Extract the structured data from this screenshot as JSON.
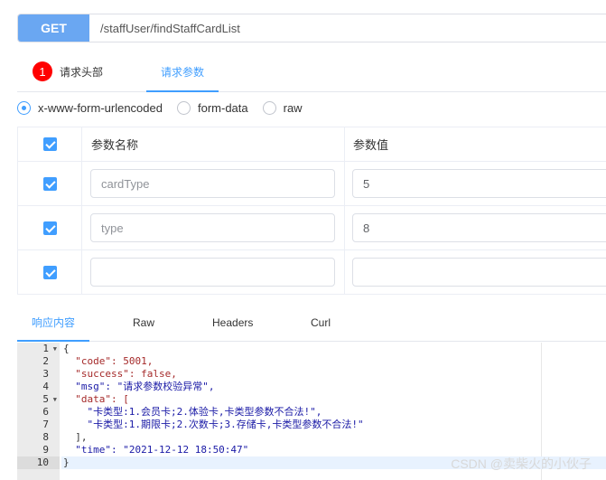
{
  "request": {
    "method": "GET",
    "url": "/staffUser/findStaffCardList"
  },
  "req_tabs": {
    "headers_badge": "1",
    "headers_label": "请求头部",
    "params_label": "请求参数"
  },
  "body_types": {
    "urlencoded": "x-www-form-urlencoded",
    "formdata": "form-data",
    "raw": "raw"
  },
  "params_table": {
    "col_name": "参数名称",
    "col_value": "参数值",
    "rows": [
      {
        "name": "cardType",
        "value": "5"
      },
      {
        "name": "type",
        "value": "8"
      },
      {
        "name": "",
        "value": ""
      }
    ]
  },
  "resp_tabs": {
    "content": "响应内容",
    "raw": "Raw",
    "headers": "Headers",
    "curl": "Curl"
  },
  "response_lines": [
    "{",
    "  \"code\": 5001,",
    "  \"success\": false,",
    "  \"msg\": \"请求参数校验异常\",",
    "  \"data\": [",
    "    \"卡类型:1.会员卡;2.体验卡,卡类型参数不合法!\",",
    "    \"卡类型:1.期限卡;2.次数卡;3.存储卡,卡类型参数不合法!\"",
    "  ],",
    "  \"time\": \"2021-12-12 18:50:47\"",
    "}"
  ],
  "watermark": "CSDN @卖柴火的小伙子",
  "colors": {
    "method_bg": "#6aa7f2",
    "accent": "#409eff",
    "badge": "#ff0000"
  }
}
